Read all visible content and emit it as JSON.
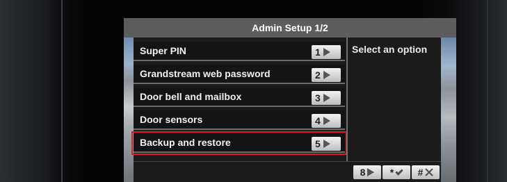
{
  "header": {
    "title": "Admin Setup 1/2"
  },
  "menu": {
    "items": [
      {
        "label": "Super PIN",
        "key": "1"
      },
      {
        "label": "Grandstream web password",
        "key": "2"
      },
      {
        "label": "Door bell and mailbox",
        "key": "3"
      },
      {
        "label": "Door sensors",
        "key": "4"
      },
      {
        "label": "Backup and restore",
        "key": "5",
        "selected": true
      }
    ]
  },
  "info": {
    "text": "Select an option"
  },
  "footer": {
    "keys": [
      {
        "label": "8",
        "icon": "next-arrow-icon"
      },
      {
        "label": "*",
        "icon": "confirm-check-icon"
      },
      {
        "label": "#",
        "icon": "cancel-x-icon"
      }
    ]
  },
  "colors": {
    "selection": "#d3202f",
    "title_bar": "#5d5d5d",
    "key_badge": "#d9d9d9"
  }
}
